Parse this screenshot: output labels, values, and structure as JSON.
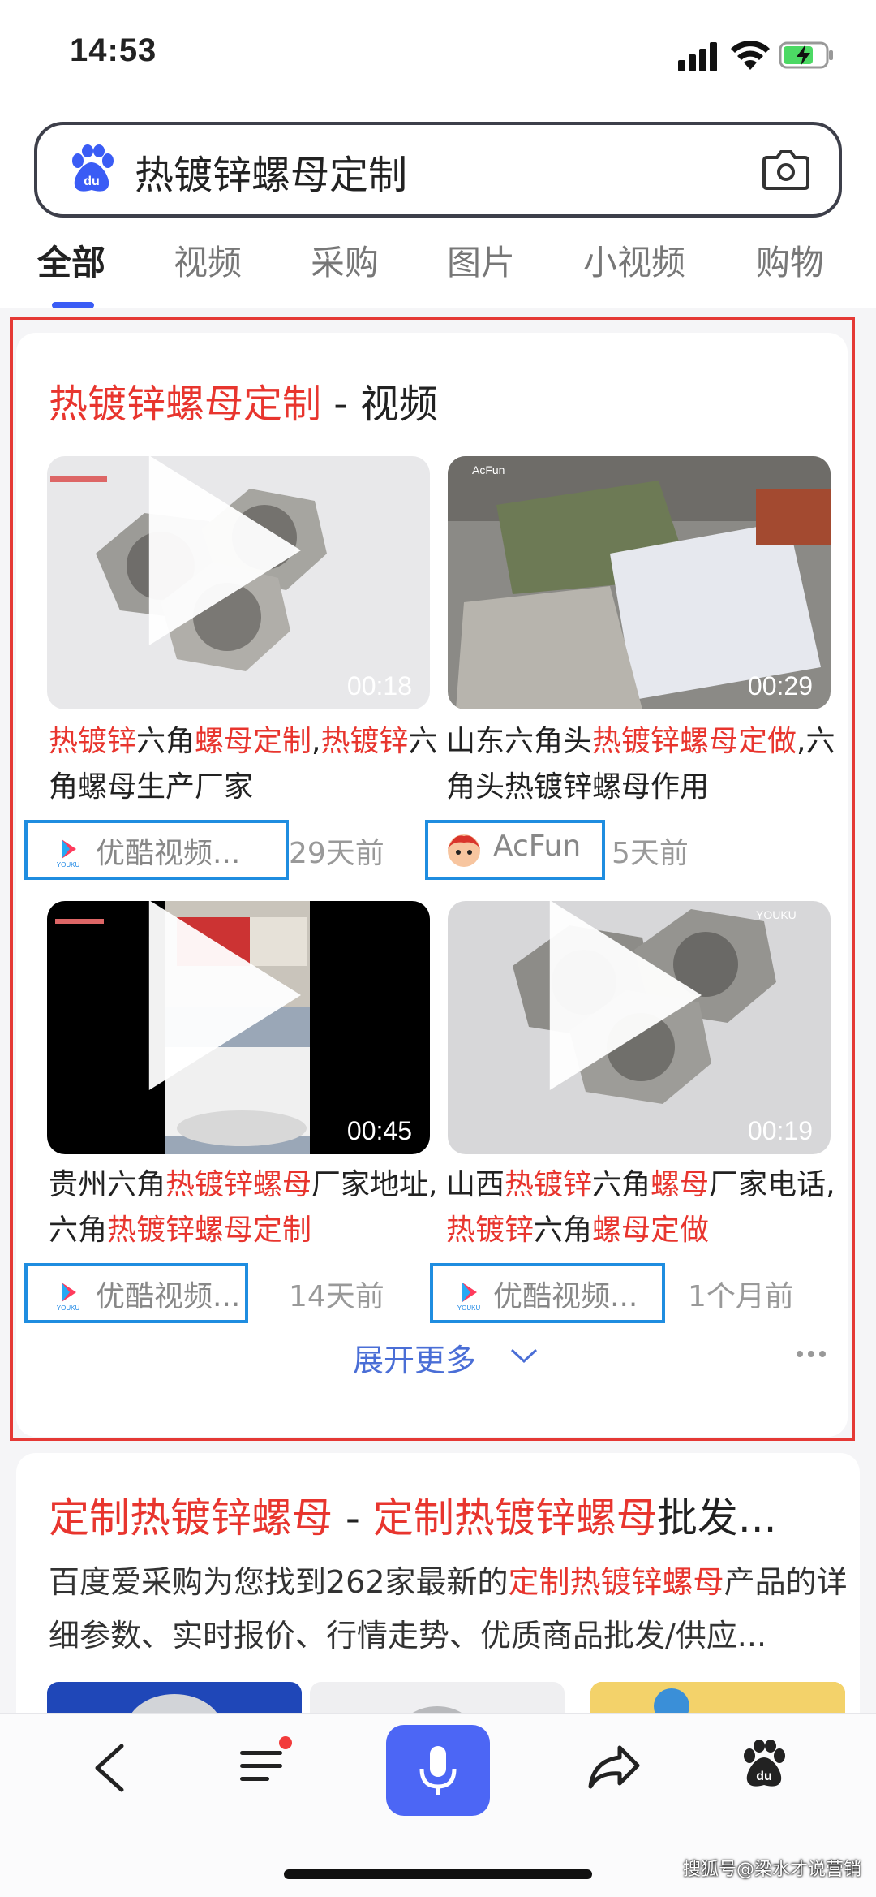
{
  "status_bar": {
    "time": "14:53"
  },
  "search": {
    "query": "热镀锌螺母定制"
  },
  "tabs": [
    {
      "label": "全部",
      "active": true
    },
    {
      "label": "视频"
    },
    {
      "label": "采购"
    },
    {
      "label": "图片"
    },
    {
      "label": "小视频"
    },
    {
      "label": "购物"
    }
  ],
  "video_card": {
    "title_highlight": "热镀锌螺母定制",
    "title_suffix": " - 视频",
    "videos": [
      {
        "duration": "00:18",
        "title_parts": [
          {
            "t": "热镀锌",
            "hl": true
          },
          {
            "t": "六角",
            "hl": false
          },
          {
            "t": "螺母定制",
            "hl": true
          },
          {
            "t": ",",
            "hl": false
          },
          {
            "t": "热镀锌",
            "hl": true
          },
          {
            "t": "六角螺母生产厂家",
            "hl": false
          }
        ],
        "source": "优酷视频...",
        "time": "29天前"
      },
      {
        "duration": "00:29",
        "title_parts": [
          {
            "t": "山东六角头",
            "hl": false
          },
          {
            "t": "热镀锌螺母定做",
            "hl": true
          },
          {
            "t": ",六角头热镀锌螺母作用",
            "hl": false
          }
        ],
        "source": "AcFun",
        "time": "5天前"
      },
      {
        "duration": "00:45",
        "title_parts": [
          {
            "t": "贵州六角",
            "hl": false
          },
          {
            "t": "热镀锌螺母",
            "hl": true
          },
          {
            "t": "厂家地址,六角",
            "hl": false
          },
          {
            "t": "热镀锌螺母定制",
            "hl": true
          }
        ],
        "source": "优酷视频...",
        "time": "14天前"
      },
      {
        "duration": "00:19",
        "title_parts": [
          {
            "t": "山西",
            "hl": false
          },
          {
            "t": "热镀锌",
            "hl": true
          },
          {
            "t": "六角",
            "hl": false
          },
          {
            "t": "螺母",
            "hl": true
          },
          {
            "t": "厂家电话,",
            "hl": false
          },
          {
            "t": "热镀锌",
            "hl": true
          },
          {
            "t": "六角",
            "hl": false
          },
          {
            "t": "螺母定做",
            "hl": true
          }
        ],
        "source": "优酷视频...",
        "time": "1个月前"
      }
    ],
    "expand_label": "展开更多"
  },
  "result2": {
    "title_parts": [
      {
        "t": "定制热镀锌螺母",
        "hl": true
      },
      {
        "t": " - ",
        "hl": false
      },
      {
        "t": "定制热镀锌螺母",
        "hl": true
      },
      {
        "t": "批发...",
        "hl": false
      }
    ],
    "desc_parts": [
      {
        "t": "百度爱采购为您找到262家最新的",
        "hl": false
      },
      {
        "t": "定制热镀锌螺母",
        "hl": true
      },
      {
        "t": "产品的详细参数、实时报价、行情走势、优质商品批发/供应...",
        "hl": false
      }
    ]
  },
  "watermark": "搜狐号@梁水才说营销",
  "colors": {
    "highlight": "#e8352e",
    "accent": "#4c66f5",
    "annotation_red": "#e53935",
    "annotation_blue": "#1f8de0"
  }
}
